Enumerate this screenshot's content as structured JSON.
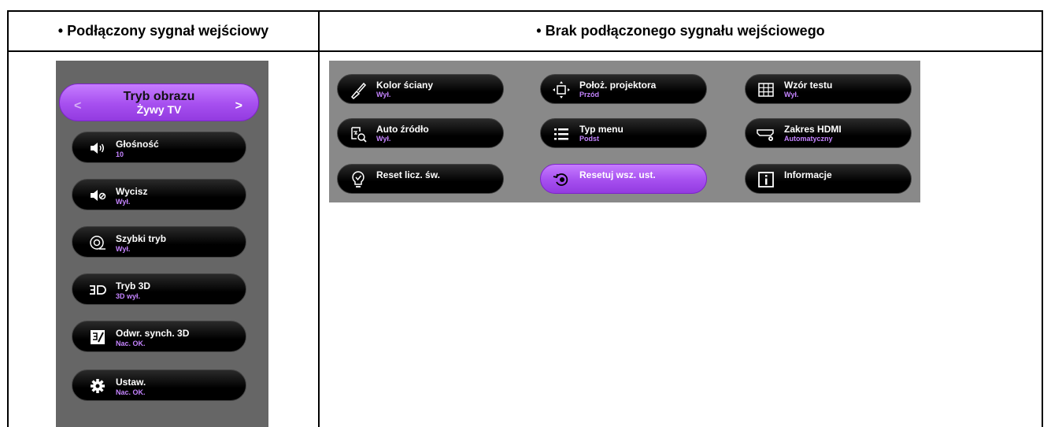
{
  "header": {
    "left": "• Podłączony sygnał wejściowy",
    "right": "• Brak podłączonego sygnału wejściowego"
  },
  "left_menu": {
    "picture_mode": {
      "label": "Tryb obrazu",
      "value": "Żywy TV",
      "prev": "<",
      "next": ">"
    },
    "items": [
      {
        "label": "Głośność",
        "value": "10",
        "icon": "volume-icon"
      },
      {
        "label": "Wycisz",
        "value": "Wył.",
        "icon": "mute-icon"
      },
      {
        "label": "Szybki tryb",
        "value": "Wył.",
        "icon": "fast-mode-icon"
      },
      {
        "label": "Tryb 3D",
        "value": "3D wył.",
        "icon": "3d-icon"
      },
      {
        "label": "Odwr. synch. 3D",
        "value": "Nac. OK.",
        "icon": "3d-sync-invert-icon"
      },
      {
        "label": "Ustaw.",
        "value": "Nac. OK.",
        "icon": "gear-icon"
      }
    ]
  },
  "right_menu": {
    "items": [
      {
        "label": "Kolor ściany",
        "value": "Wył.",
        "icon": "paint-brush-icon"
      },
      {
        "label": "Położ. projektora",
        "value": "Przód",
        "icon": "projector-position-icon"
      },
      {
        "label": "Wzór testu",
        "value": "Wył.",
        "icon": "test-pattern-icon"
      },
      {
        "label": "Auto źródło",
        "value": "Wył.",
        "icon": "auto-source-icon"
      },
      {
        "label": "Typ menu",
        "value": "Podst",
        "icon": "menu-list-icon"
      },
      {
        "label": "Zakres HDMI",
        "value": "Automatyczny",
        "icon": "hdmi-range-icon"
      },
      {
        "label": "Reset licz. św.",
        "value": "",
        "icon": "lamp-reset-icon"
      },
      {
        "label": "Resetuj wsz. ust.",
        "value": "",
        "icon": "reset-all-icon",
        "selected": true
      },
      {
        "label": "Informacje",
        "value": "",
        "icon": "info-icon"
      }
    ]
  },
  "colors": {
    "accent": "#a64fef",
    "value_text": "#c584ff"
  }
}
